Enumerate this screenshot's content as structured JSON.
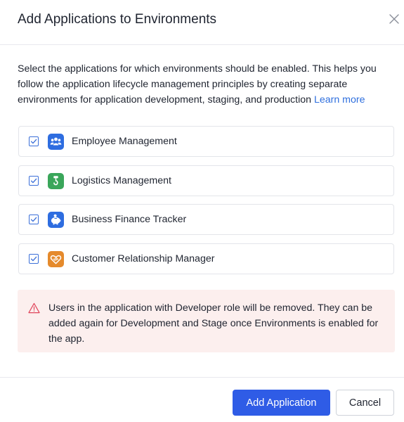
{
  "dialog": {
    "title": "Add Applications to Environments",
    "intro_text": "Select the applications for which environments should be enabled. This helps you follow the application lifecycle management principles by creating separate environments for application development, staging, and production ",
    "learn_more": "Learn more"
  },
  "applications": [
    {
      "label": "Employee Management",
      "checked": true,
      "icon": "people-icon",
      "color": "#2e6de0"
    },
    {
      "label": "Logistics Management",
      "checked": true,
      "icon": "crane-hook-icon",
      "color": "#3aa65a"
    },
    {
      "label": "Business Finance Tracker",
      "checked": true,
      "icon": "piggy-bank-icon",
      "color": "#2e6de0"
    },
    {
      "label": "Customer Relationship Manager",
      "checked": true,
      "icon": "handshake-icon",
      "color": "#e58a2c"
    }
  ],
  "warning": {
    "text": "Users in the application with Developer role will be removed. They can be added again for Development and Stage once Environments is enabled for the app.",
    "icon": "warning-icon",
    "color": "#e0445a"
  },
  "footer": {
    "primary_label": "Add Application",
    "secondary_label": "Cancel"
  },
  "colors": {
    "accent": "#2f5ce6",
    "link": "#2f6fde",
    "warning_bg": "#fcefee"
  }
}
